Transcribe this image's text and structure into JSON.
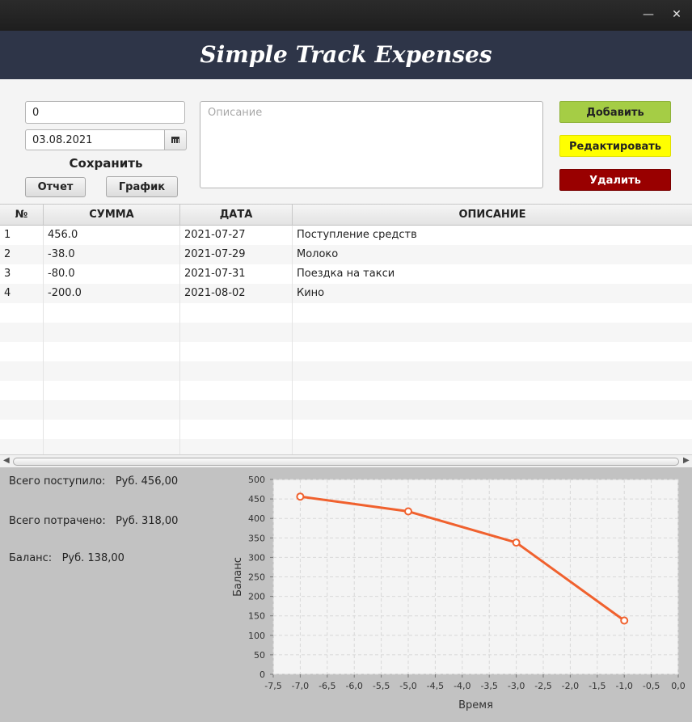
{
  "window": {
    "minimize_glyph": "—",
    "close_glyph": "✕",
    "title": "Simple Track Expenses"
  },
  "form": {
    "amount_value": "0",
    "date_value": "03.08.2021",
    "save_label": "Сохранить",
    "report_label": "Отчет",
    "chart_label": "График",
    "description_placeholder": "Описание"
  },
  "actions": {
    "add_label": "Добавить",
    "add_color": "#a5cd45",
    "edit_label": "Редактировать",
    "edit_color": "#ffff00",
    "delete_label": "Удалить",
    "delete_color": "#990000"
  },
  "table": {
    "headers": [
      "№",
      "СУММА",
      "ДАТА",
      "ОПИСАНИЕ"
    ],
    "rows": [
      [
        "1",
        "456.0",
        "2021-07-27",
        "Поступление средств"
      ],
      [
        "2",
        "-38.0",
        "2021-07-29",
        "Молоко"
      ],
      [
        "3",
        "-80.0",
        "2021-07-31",
        "Поездка на такси"
      ],
      [
        "4",
        "-200.0",
        "2021-08-02",
        "Кино"
      ]
    ]
  },
  "summary": {
    "income_label": "Всего поступило:",
    "income_value": "Руб. 456,00",
    "spent_label": "Всего потрачено:",
    "spent_value": "Руб. 318,00",
    "balance_label": "Баланс:",
    "balance_value": "Руб. 138,00"
  },
  "chart_data": {
    "type": "line",
    "title": "",
    "xlabel": "Время",
    "ylabel": "Баланс",
    "xlim": [
      -7.5,
      0
    ],
    "ylim": [
      0,
      500
    ],
    "x_ticks": [
      "-7,5",
      "-7,0",
      "-6,5",
      "-6,0",
      "-5,5",
      "-5,0",
      "-4,5",
      "-4,0",
      "-3,5",
      "-3,0",
      "-2,5",
      "-2,0",
      "-1,5",
      "-1,0",
      "-0,5",
      "0,0"
    ],
    "y_ticks": [
      "0",
      "50",
      "100",
      "150",
      "200",
      "250",
      "300",
      "350",
      "400",
      "450",
      "500"
    ],
    "grid": true,
    "series": [
      {
        "color": "#f0612e",
        "x": [
          -7,
          -5,
          -3,
          -1
        ],
        "y": [
          456,
          418,
          338,
          138
        ]
      }
    ]
  }
}
